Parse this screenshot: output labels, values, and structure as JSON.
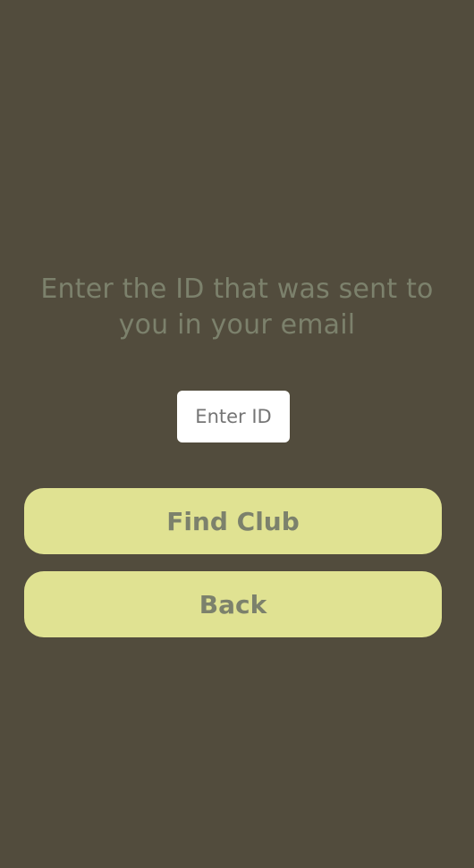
{
  "screen": {
    "prompt_text": "Enter the ID that was sent to you in your email"
  },
  "id_input": {
    "value": "",
    "placeholder": "Enter ID"
  },
  "buttons": {
    "find_club_label": "Find Club",
    "back_label": "Back"
  },
  "colors": {
    "background": "#524c3d",
    "text_muted": "#7c816c",
    "button_fill": "#e0e292",
    "input_fill": "#ffffff"
  }
}
